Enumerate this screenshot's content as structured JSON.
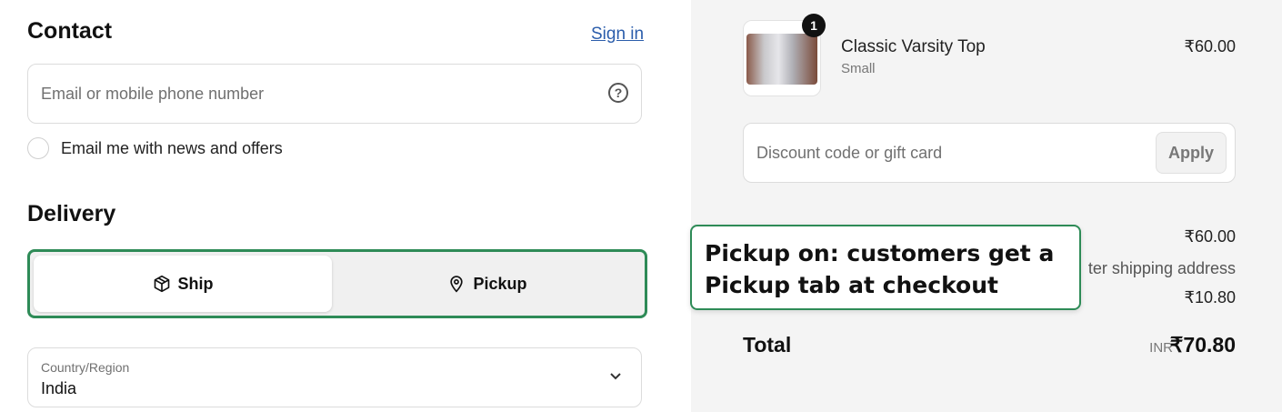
{
  "contact": {
    "heading": "Contact",
    "sign_in_label": "Sign in",
    "email_placeholder": "Email or mobile phone number",
    "news_checkbox_label": "Email me with news and offers"
  },
  "delivery": {
    "heading": "Delivery",
    "options": [
      {
        "label": "Ship",
        "icon": "box-icon",
        "selected": true
      },
      {
        "label": "Pickup",
        "icon": "location-pin-icon",
        "selected": false
      }
    ],
    "country_label": "Country/Region",
    "country_value": "India"
  },
  "order": {
    "item": {
      "name": "Classic Varsity Top",
      "variant": "Small",
      "price": "₹60.00",
      "quantity": "1"
    },
    "discount_placeholder": "Discount code or gift card",
    "apply_label": "Apply",
    "subtotal_value": "₹60.00",
    "shipping_note": "ter shipping address",
    "taxes_value": "₹10.80",
    "total_label": "Total",
    "total_currency": "INR",
    "total_value": "₹70.80"
  },
  "callout": {
    "text": "Pickup on: customers get a Pickup tab at checkout"
  },
  "colors": {
    "highlight_green": "#2e8b57",
    "link_blue": "#2b5dab",
    "summary_bg": "#f4f4f4"
  }
}
